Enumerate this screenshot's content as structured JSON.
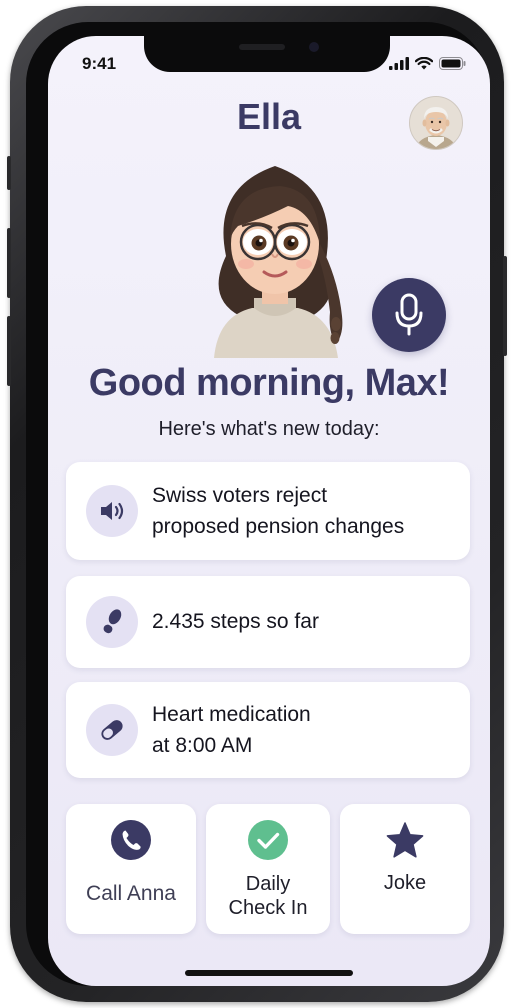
{
  "status_bar": {
    "time": "9:41"
  },
  "header": {
    "title": "Ella"
  },
  "greeting": "Good morning, Max!",
  "subtitle": "Here's what's new today:",
  "cards": [
    {
      "line1": "Swiss voters reject",
      "line2": "proposed pension changes",
      "icon": "speaker-icon"
    },
    {
      "line1": "2.435 steps so far",
      "line2": "",
      "icon": "footprint-icon"
    },
    {
      "line1": "Heart medication",
      "line2": "at 8:00 AM",
      "icon": "pill-icon"
    }
  ],
  "actions": {
    "call": {
      "label": "Call Anna",
      "icon": "phone-icon",
      "color": "#3b3a64"
    },
    "checkin": {
      "line1": "Daily",
      "line2": "Check In",
      "icon": "check-circle-icon",
      "color": "#5fbf8f"
    },
    "joke": {
      "label": "Joke",
      "icon": "star-icon",
      "color": "#3b3a64"
    }
  },
  "colors": {
    "accent": "#3b3a64",
    "icon_bg": "#e4e1f3",
    "screen_bg": "#efedf8"
  }
}
